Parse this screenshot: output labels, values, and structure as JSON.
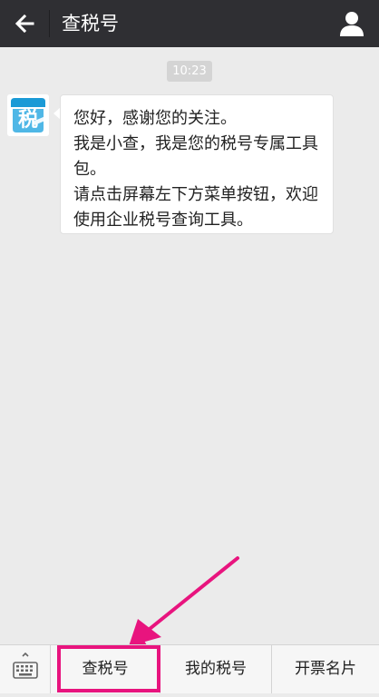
{
  "header": {
    "title": "查税号",
    "back_icon": "arrow-left-icon",
    "profile_icon": "person-icon"
  },
  "chat": {
    "timestamp": "10:23",
    "avatar_icon": "tax-logo-icon",
    "message_lines": [
      "您好，感谢您的关注。",
      "我是小查，我是您的税号专属工具包。",
      "请点击屏幕左下方菜单按钮，欢迎使用企业税号查询工具。"
    ]
  },
  "bottom_menu": {
    "keyboard_icon": "keyboard-icon",
    "items": [
      {
        "label": "查税号"
      },
      {
        "label": "我的税号"
      },
      {
        "label": "开票名片"
      }
    ]
  },
  "annotation": {
    "color": "#e8147e"
  },
  "colors": {
    "header_bg": "#2f2f33",
    "chat_bg": "#ebebeb",
    "bubble_bg": "#ffffff",
    "logo_blue": "#1a9ad6"
  }
}
